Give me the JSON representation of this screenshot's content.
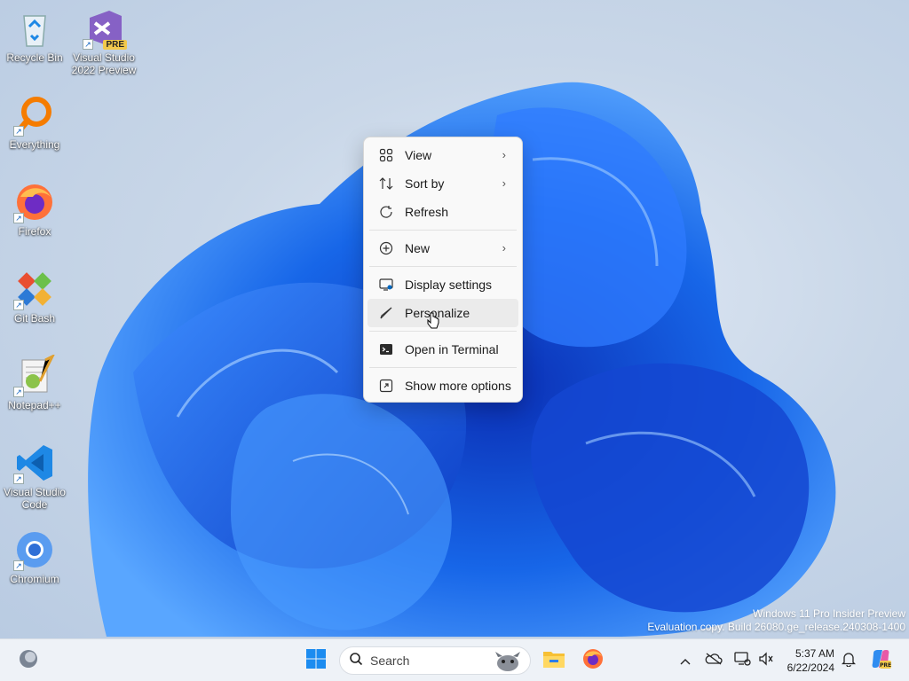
{
  "desktop": {
    "icons": [
      {
        "label": "Recycle Bin",
        "icon": "recycle-bin-icon"
      },
      {
        "label": "Visual Studio 2022 Preview",
        "icon": "visual-studio-icon",
        "badge": "PRE"
      },
      {
        "label": "Everything",
        "icon": "everything-search-icon"
      },
      {
        "label": "Firefox",
        "icon": "firefox-icon"
      },
      {
        "label": "Git Bash",
        "icon": "git-bash-icon"
      },
      {
        "label": "Notepad++",
        "icon": "notepad-plus-plus-icon"
      },
      {
        "label": "Visual Studio Code",
        "icon": "vscode-icon"
      },
      {
        "label": "Chromium",
        "icon": "chromium-icon"
      }
    ]
  },
  "context_menu": {
    "items": [
      {
        "label": "View",
        "icon": "view-grid-icon",
        "submenu": true
      },
      {
        "label": "Sort by",
        "icon": "sort-icon",
        "submenu": true
      },
      {
        "label": "Refresh",
        "icon": "refresh-icon",
        "submenu": false
      },
      {
        "label": "New",
        "icon": "new-plus-icon",
        "submenu": true
      },
      {
        "label": "Display settings",
        "icon": "display-settings-icon",
        "submenu": false
      },
      {
        "label": "Personalize",
        "icon": "personalize-brush-icon",
        "submenu": false,
        "hovered": true
      },
      {
        "label": "Open in Terminal",
        "icon": "terminal-icon",
        "submenu": false
      },
      {
        "label": "Show more options",
        "icon": "show-more-options-icon",
        "submenu": false
      }
    ]
  },
  "watermark": {
    "line1": "Windows 11 Pro Insider Preview",
    "line2": "Evaluation copy. Build 26080.ge_release.240308-1400"
  },
  "taskbar": {
    "search_placeholder": "Search",
    "time": "5:37 AM",
    "date": "6/22/2024",
    "pinned": [
      "widgets-icon",
      "start-icon",
      "file-explorer-icon",
      "firefox-icon"
    ],
    "tray": [
      "chevron-up-icon",
      "onedrive-icon",
      "network-icon",
      "volume-icon",
      "notification-bell-icon",
      "copilot-icon"
    ]
  },
  "colors": {
    "accent": "#0067c0",
    "wallpaper_bloom": "#1a5fe0"
  }
}
